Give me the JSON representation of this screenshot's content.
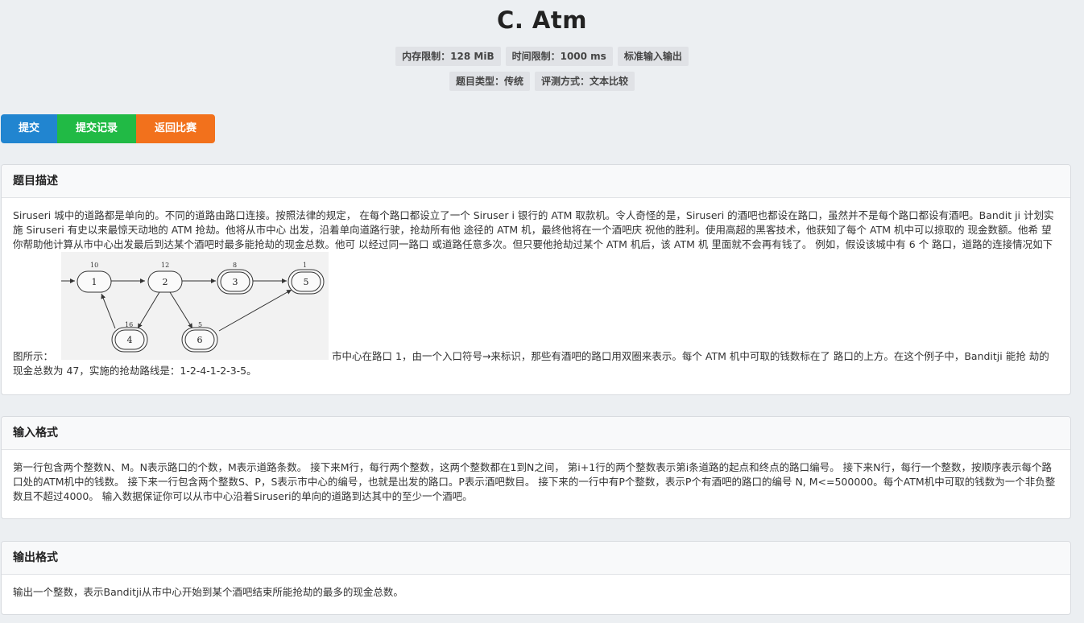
{
  "title": "C. Atm",
  "meta_row1": [
    "内存限制：128 MiB",
    "时间限制：1000 ms",
    "标准输入输出"
  ],
  "meta_row2": [
    "题目类型：传统",
    "评测方式：文本比较"
  ],
  "buttons": {
    "submit": "提交",
    "records": "提交记录",
    "back": "返回比赛",
    "colors": {
      "submit": "#2185d0",
      "records": "#21ba45",
      "back": "#f2711c"
    }
  },
  "description": {
    "heading": "题目描述",
    "text_before": "Siruseri 城中的道路都是单向的。不同的道路由路口连接。按照法律的规定， 在每个路口都设立了一个 Siruser i 银行的 ATM 取款机。令人奇怪的是，Siruseri 的酒吧也都设在路口，虽然并不是每个路口都设有酒吧。Bandit ji 计划实施 Siruseri 有史以来最惊天动地的 ATM 抢劫。他将从市中心 出发，沿着单向道路行驶，抢劫所有他 途径的 ATM 机，最终他将在一个酒吧庆 祝他的胜利。使用高超的黑客技术，他获知了每个 ATM 机中可以掠取的 现金数额。他希 望你帮助他计算从市中心出发最后到达某个酒吧时最多能抢劫的现金总数。他可 以经过同一路口 或道路任意多次。但只要他抢劫过某个 ATM 机后，该 ATM 机 里面就不会再有钱了。 例如，假设该城中有 6 个 路口，道路的连接情况如下图所示：",
    "text_after": "市中心在路口 1，由一个入口符号→来标识，那些有酒吧的路口用双圈来表示。每个 ATM 机中可取的钱数标在了 路口的上方。在这个例子中，Banditji 能抢 劫的现金总数为 47，实施的抢劫路线是：1-2-4-1-2-3-5。",
    "figure": {
      "nodes": [
        {
          "id": "1",
          "money": "10",
          "bar": false
        },
        {
          "id": "2",
          "money": "12",
          "bar": false
        },
        {
          "id": "3",
          "money": "8",
          "bar": true
        },
        {
          "id": "5",
          "money": "1",
          "bar": true
        },
        {
          "id": "4",
          "money": "16",
          "bar": true
        },
        {
          "id": "6",
          "money": "5",
          "bar": true
        }
      ]
    }
  },
  "input": {
    "heading": "输入格式",
    "text": "第一行包含两个整数N、M。N表示路口的个数，M表示道路条数。 接下来M行，每行两个整数，这两个整数都在1到N之间， 第i+1行的两个整数表示第i条道路的起点和终点的路口编号。 接下来N行，每行一个整数，按顺序表示每个路口处的ATM机中的钱数。 接下来一行包含两个整数S、P，S表示市中心的编号，也就是出发的路口。P表示酒吧数目。 接下来的一行中有P个整数，表示P个有酒吧的路口的编号 N, M<=500000。每个ATM机中可取的钱数为一个非负整数且不超过4000。 输入数据保证你可以从市中心沿着Siruseri的单向的道路到达其中的至少一个酒吧。"
  },
  "output": {
    "heading": "输出格式",
    "text": "输出一个整数，表示Banditji从市中心开始到某个酒吧结束所能抢劫的最多的现金总数。"
  }
}
